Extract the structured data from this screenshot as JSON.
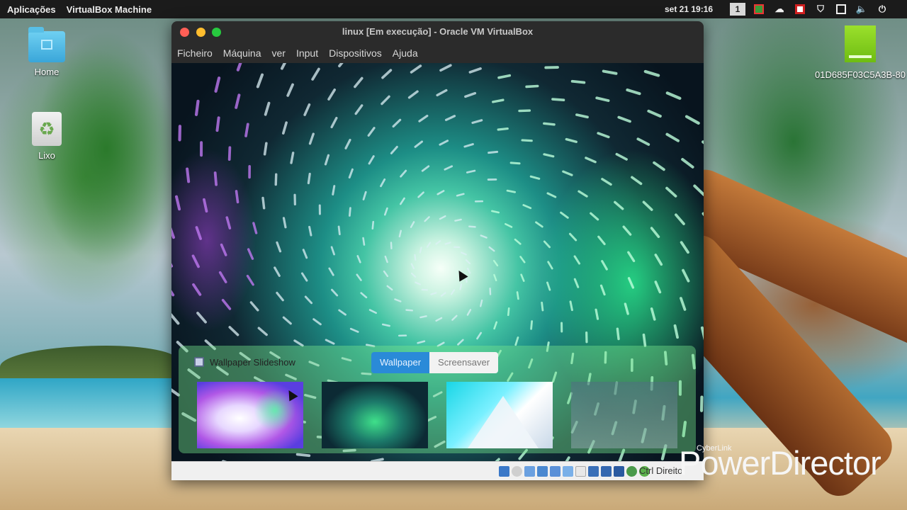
{
  "top_panel": {
    "apps_menu": "Aplicações",
    "active_app": "VirtualBox Machine",
    "clock": "set 21  19:16",
    "workspace_number": "1",
    "tray_icons": [
      "workspace-icon",
      "chart-icon",
      "cloud-icon",
      "record-icon",
      "shield-icon",
      "window-icon",
      "volume-icon",
      "power-icon"
    ]
  },
  "desktop": {
    "icons": [
      {
        "label": "Home",
        "icon": "home-folder-icon"
      },
      {
        "label": "Lixo",
        "icon": "trash-icon"
      },
      {
        "label": "01D685F03C5A3B-80",
        "icon": "drive-icon"
      }
    ]
  },
  "vbox": {
    "title": "linux [Em execução] - Oracle VM VirtualBox",
    "menu": [
      "Ficheiro",
      "Máquina",
      "ver",
      "Input",
      "Dispositivos",
      "Ajuda"
    ],
    "host_key": "Ctrl Direito"
  },
  "guest": {
    "slideshow_label": "Wallpaper Slideshow",
    "slideshow_checked": true,
    "tabs": [
      "Wallpaper",
      "Screensaver"
    ],
    "active_tab": "Wallpaper",
    "thumbnails": [
      "purple-aurora",
      "green-aurora-dark",
      "cyan-pyramid",
      "faded-texture"
    ]
  },
  "watermark": {
    "brand": "CyberLink",
    "product": "PowerDirector"
  },
  "colors": {
    "top_panel": "#1b1b1b",
    "vbox_frame": "#2b2b2b",
    "accent_blue": "#2a8ad8",
    "close": "#ff5f56",
    "minimize": "#ffbd2e",
    "maximize": "#27c93f"
  }
}
